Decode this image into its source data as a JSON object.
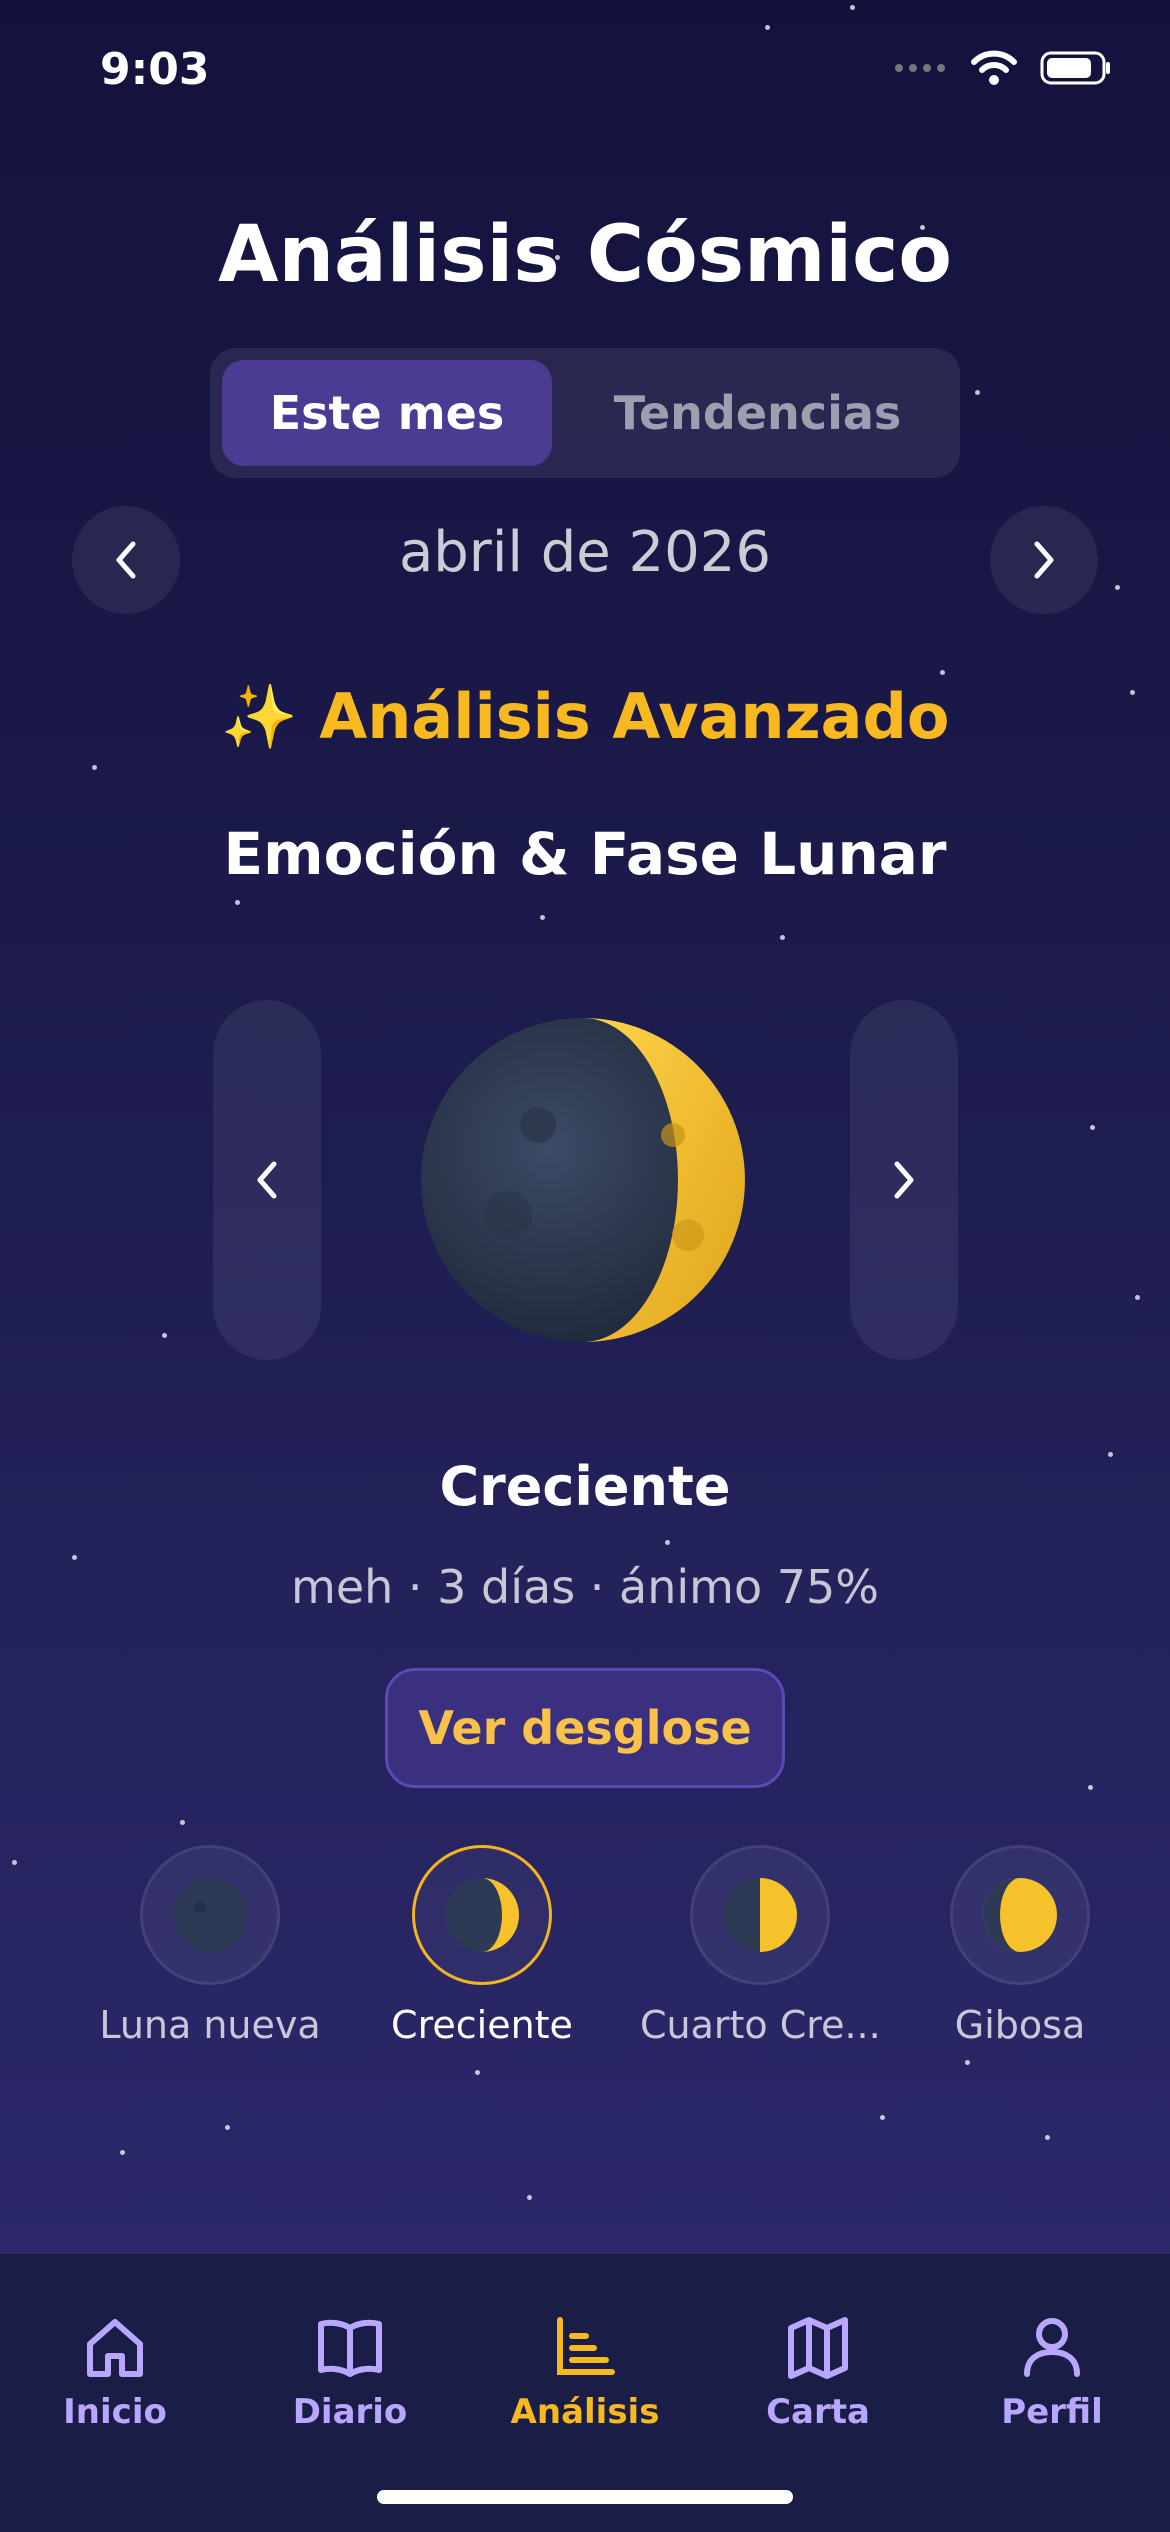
{
  "status_bar": {
    "time": "9:03"
  },
  "header": {
    "title": "Análisis Cósmico"
  },
  "tabs": [
    {
      "label": "Este mes",
      "active": true
    },
    {
      "label": "Tendencias",
      "active": false
    }
  ],
  "month_nav": {
    "label": "abril de 2026"
  },
  "advanced": {
    "heading": "✨ Análisis Avanzado",
    "subheading": "Emoción & Fase Lunar"
  },
  "current_phase": {
    "name": "Creciente",
    "stats": "meh · 3 días · ánimo 75%",
    "button": "Ver desglose"
  },
  "phase_list": [
    {
      "label": "Luna nueva",
      "selected": false
    },
    {
      "label": "Creciente",
      "selected": true
    },
    {
      "label": "Cuarto Cre...",
      "selected": false
    },
    {
      "label": "Gibosa",
      "selected": false
    }
  ],
  "tab_bar": {
    "items": [
      {
        "label": "Inicio",
        "icon": "home-icon"
      },
      {
        "label": "Diario",
        "icon": "book-icon"
      },
      {
        "label": "Análisis",
        "icon": "chart-icon",
        "active": true
      },
      {
        "label": "Carta",
        "icon": "map-icon"
      },
      {
        "label": "Perfil",
        "icon": "user-icon"
      }
    ]
  },
  "colors": {
    "accent": "#f7b91f",
    "tab_purple": "#b9a6ff",
    "segment_active": "#4b3b93"
  }
}
